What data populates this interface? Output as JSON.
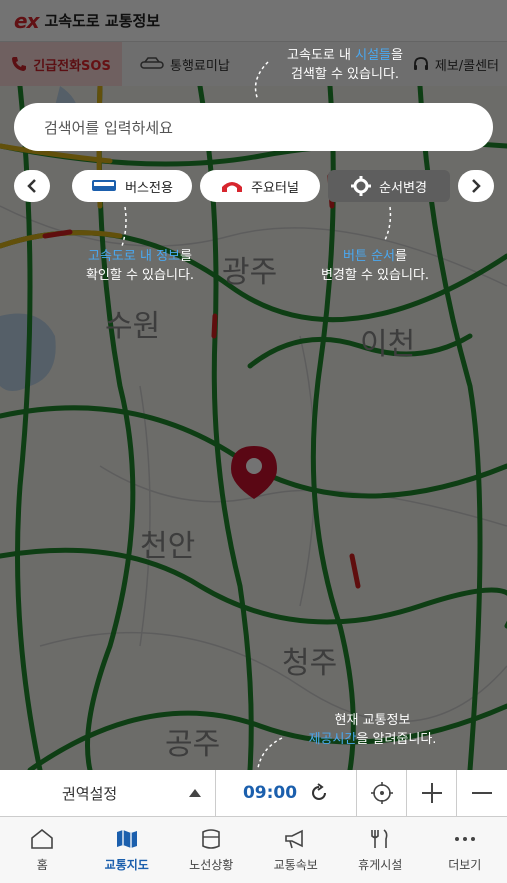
{
  "header": {
    "logo": "ex",
    "title": "고속도로 교통정보"
  },
  "quickbar": {
    "sos_label": "긴급전화",
    "sos_suffix": "SOS",
    "toll_label": "통행료미납",
    "report_label": "제보/콜센터"
  },
  "search": {
    "placeholder": "검색어를 입력하세요"
  },
  "chips": {
    "bus_label": "버스전용",
    "tunnel_label": "주요터널",
    "order_label": "순서변경"
  },
  "map_labels": [
    "광주",
    "이천",
    "수원",
    "천안",
    "청주",
    "공주"
  ],
  "callouts": {
    "facility": {
      "pre": "고속도로 내 ",
      "hl": "시설들",
      "post": "을",
      "line2": "검색할 수 있습니다."
    },
    "info": {
      "hl": "고속도로 내 정보",
      "post": "를",
      "line2": "확인할 수 있습니다."
    },
    "order": {
      "hl": "버튼 순서",
      "post": "를",
      "line2": "변경할 수 있습니다."
    },
    "time": {
      "line1": "현재 교통정보",
      "hl": "제공시간",
      "post": "을 알려줍니다."
    }
  },
  "bottombar": {
    "region_label": "권역설정",
    "time": "09:00"
  },
  "tabs": [
    {
      "label": "홈",
      "icon": "home-icon"
    },
    {
      "label": "교통지도",
      "icon": "map-icon",
      "active": true
    },
    {
      "label": "노선상황",
      "icon": "route-icon"
    },
    {
      "label": "교통속보",
      "icon": "megaphone-icon"
    },
    {
      "label": "휴게시설",
      "icon": "restaurant-icon"
    },
    {
      "label": "더보기",
      "icon": "more-icon"
    }
  ],
  "colors": {
    "road_green": "#1f8a2e",
    "road_red": "#d32020",
    "accent_blue": "#1b5fad",
    "highlight": "#4aa8f0",
    "brand_red": "#d7262e"
  }
}
